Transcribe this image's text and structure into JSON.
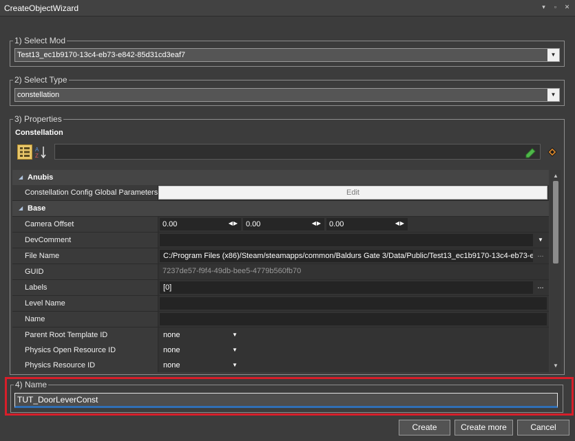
{
  "window": {
    "title": "CreateObjectWizard",
    "controls": [
      "▾",
      "▫",
      "✕"
    ]
  },
  "select_mod": {
    "legend": "1) Select Mod",
    "value": "Test13_ec1b9170-13c4-eb73-e842-85d31cd3eaf7"
  },
  "select_type": {
    "legend": "2) Select Type",
    "value": "constellation"
  },
  "properties": {
    "legend": "3) Properties",
    "header": "Constellation",
    "categories": {
      "anubis": "Anubis",
      "base": "Base"
    },
    "rows": {
      "config": {
        "name": "Constellation Config Global Parameters",
        "value": "Edit"
      },
      "camera_offset": {
        "name": "Camera Offset",
        "x": "0.00",
        "y": "0.00",
        "z": "0.00"
      },
      "dev_comment": {
        "name": "DevComment",
        "value": ""
      },
      "file_name": {
        "name": "File Name",
        "value": "C:/Program Files (x86)/Steam/steamapps/common/Baldurs Gate 3/Data/Public/Test13_ec1b9170-13c4-eb73-e"
      },
      "guid": {
        "name": "GUID",
        "value": "7237de57-f9f4-49db-bee5-4779b560fb70"
      },
      "labels": {
        "name": "Labels",
        "value": "[0]"
      },
      "level_name": {
        "name": "Level Name",
        "value": ""
      },
      "name": {
        "name": "Name",
        "value": ""
      },
      "parent_root": {
        "name": "Parent Root Template ID",
        "value": "none"
      },
      "physics_open": {
        "name": "Physics Open Resource ID",
        "value": "none"
      },
      "physics_res": {
        "name": "Physics Resource ID",
        "value": "none"
      }
    }
  },
  "name_section": {
    "legend": "4) Name",
    "value": "TUT_DoorLeverConst"
  },
  "buttons": {
    "create": "Create",
    "create_more": "Create more",
    "cancel": "Cancel"
  },
  "colors": {
    "highlight": "#d81e2a",
    "accent": "#2f6fb6",
    "background": "#3c3c3c"
  }
}
